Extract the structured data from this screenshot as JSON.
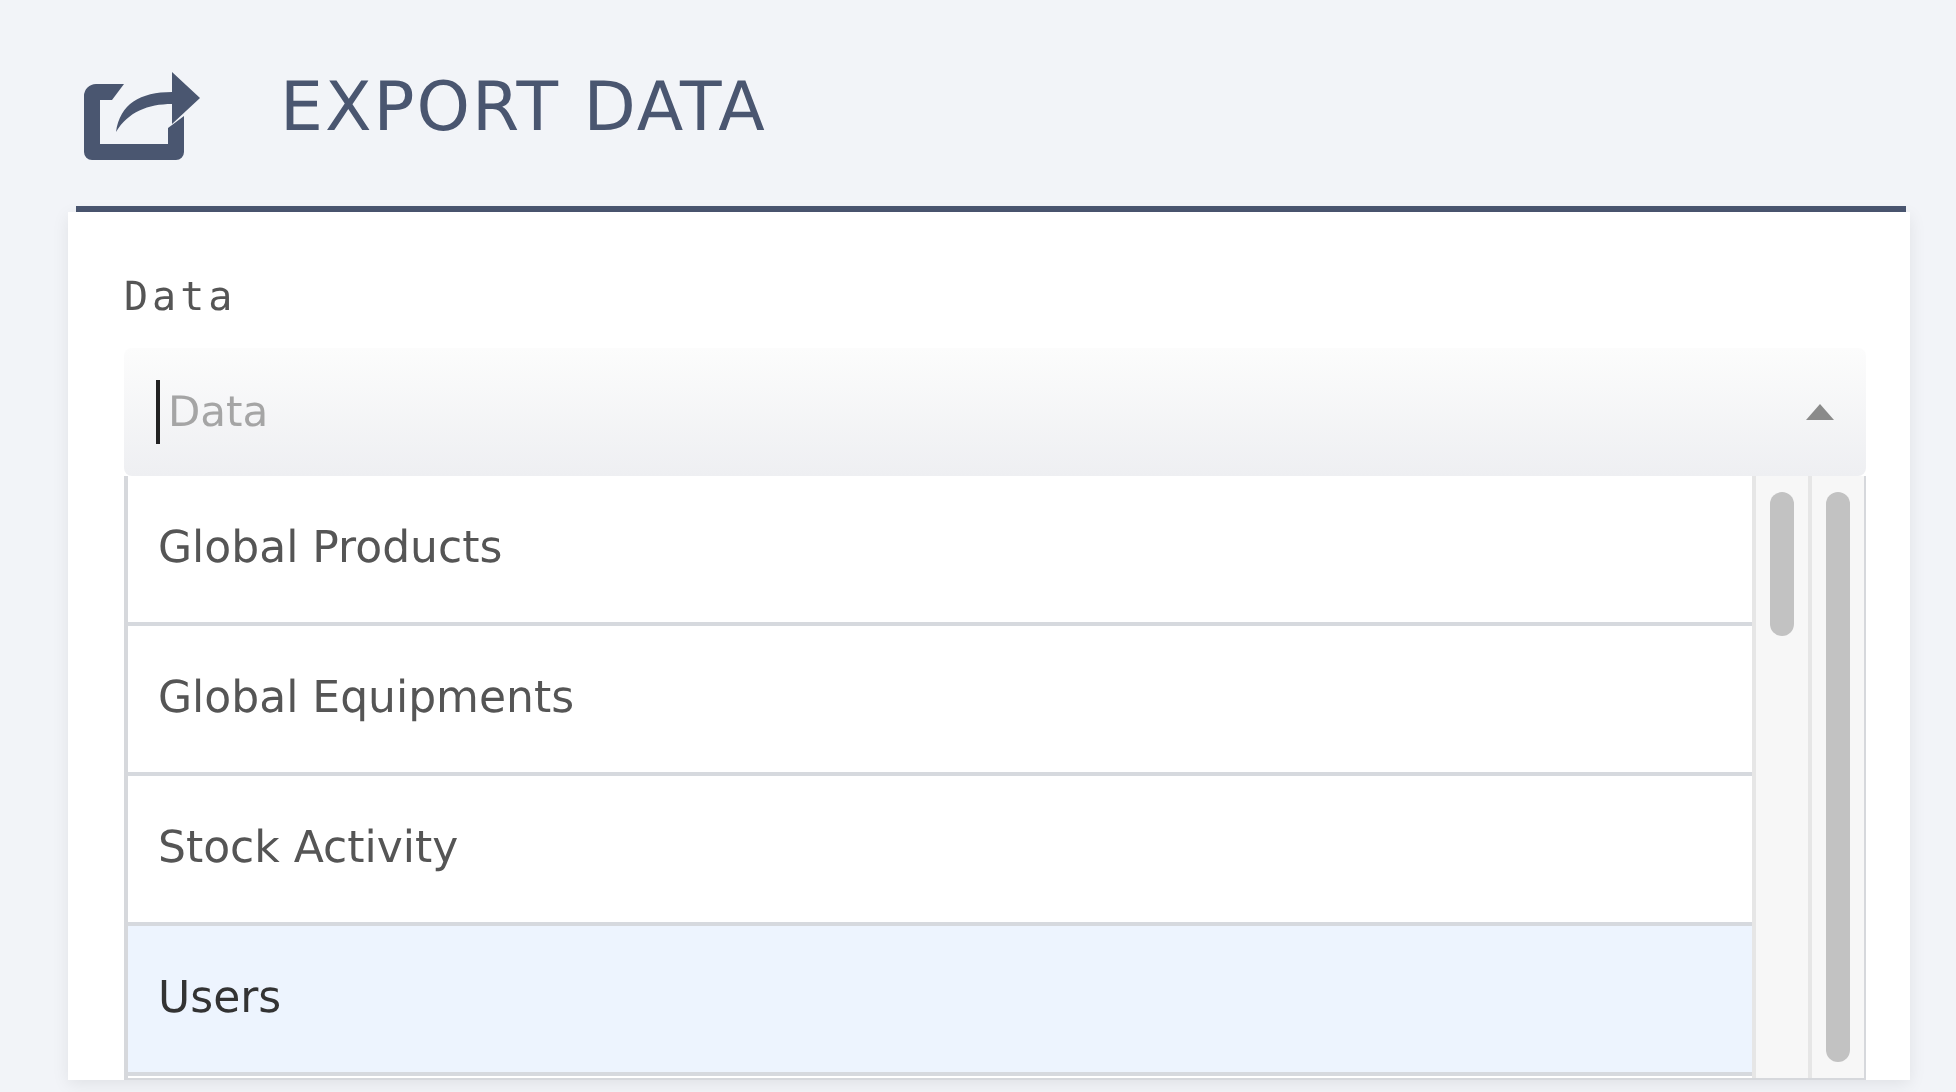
{
  "header": {
    "title": "EXPORT DATA"
  },
  "field": {
    "label": "Data",
    "placeholder": "Data",
    "expanded": true
  },
  "options": [
    {
      "label": "Global Products",
      "selected": false
    },
    {
      "label": "Global Equipments",
      "selected": false
    },
    {
      "label": "Stock Activity",
      "selected": false
    },
    {
      "label": "Users",
      "selected": true
    }
  ]
}
